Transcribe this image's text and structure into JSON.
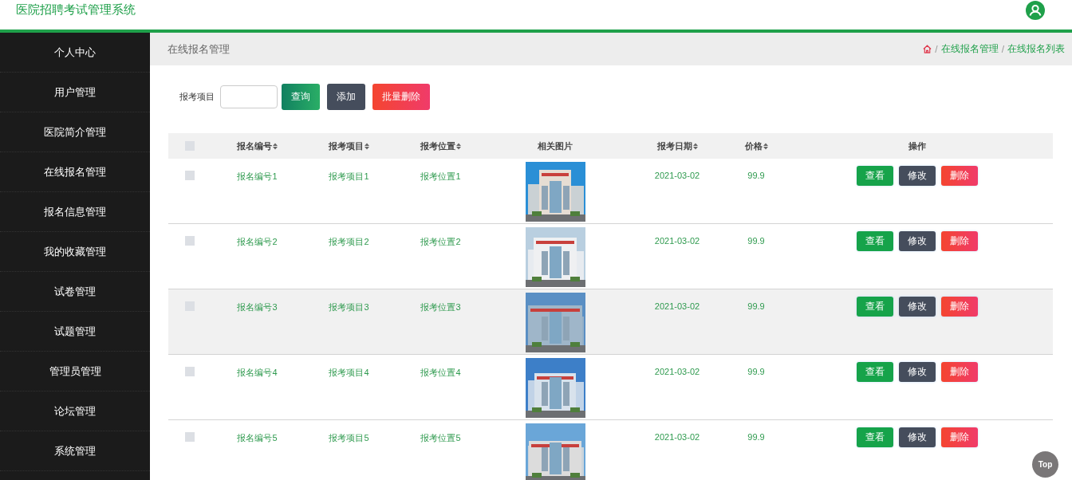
{
  "header": {
    "title": "医院招聘考试管理系统"
  },
  "sidebar": {
    "items": [
      {
        "label": "个人中心",
        "selected": false
      },
      {
        "label": "用户管理",
        "selected": false
      },
      {
        "label": "医院简介管理",
        "selected": false
      },
      {
        "label": "在线报名管理",
        "selected": false
      },
      {
        "label": "报名信息管理",
        "selected": false
      },
      {
        "label": "我的收藏管理",
        "selected": false
      },
      {
        "label": "试卷管理",
        "selected": false
      },
      {
        "label": "试题管理",
        "selected": false
      },
      {
        "label": "管理员管理",
        "selected": false
      },
      {
        "label": "论坛管理",
        "selected": false
      },
      {
        "label": "系统管理",
        "selected": false
      }
    ]
  },
  "page_title": "在线报名管理",
  "breadcrumb": [
    {
      "separator": "/",
      "label": "在线报名管理"
    },
    {
      "separator": "/",
      "label": "在线报名列表"
    }
  ],
  "search": {
    "label": "报考项目",
    "buttons": [
      {
        "label": "查询",
        "kind": "search"
      },
      {
        "label": "添加",
        "kind": "add"
      },
      {
        "label": "批量删除",
        "kind": "delete"
      }
    ]
  },
  "table": {
    "columns": [
      {
        "label": "报名编号",
        "sortable": true
      },
      {
        "label": "报考项目",
        "sortable": true
      },
      {
        "label": "报考位置",
        "sortable": true
      },
      {
        "label": "相关图片",
        "sortable": false
      },
      {
        "label": "报考日期",
        "sortable": true
      },
      {
        "label": "价格",
        "sortable": true
      },
      {
        "label": "操作",
        "sortable": false
      }
    ],
    "header_checked": false,
    "rows": [
      {
        "checked": false,
        "highlighted": false,
        "cells": [
          "报名编号1",
          "报考项目1",
          "报考位置1",
          {
            "kind": "picture"
          },
          "2021-03-02",
          "99.9",
          {
            "kind": "actions",
            "buttons": [
              {
                "label": "查看",
                "kind": "view"
              },
              {
                "label": "修改",
                "kind": "edit"
              },
              {
                "label": "删除",
                "kind": "delete"
              }
            ]
          }
        ]
      },
      {
        "checked": false,
        "highlighted": false,
        "cells": [
          "报名编号2",
          "报考项目2",
          "报考位置2",
          {
            "kind": "picture"
          },
          "2021-03-02",
          "99.9",
          {
            "kind": "actions",
            "buttons": [
              {
                "label": "查看",
                "kind": "view"
              },
              {
                "label": "修改",
                "kind": "edit"
              },
              {
                "label": "删除",
                "kind": "delete"
              }
            ]
          }
        ]
      },
      {
        "checked": false,
        "highlighted": true,
        "cells": [
          "报名编号3",
          "报考项目3",
          "报考位置3",
          {
            "kind": "picture"
          },
          "2021-03-02",
          "99.9",
          {
            "kind": "actions",
            "buttons": [
              {
                "label": "查看",
                "kind": "view"
              },
              {
                "label": "修改",
                "kind": "edit"
              },
              {
                "label": "删除",
                "kind": "delete"
              }
            ]
          }
        ]
      },
      {
        "checked": false,
        "highlighted": false,
        "cells": [
          "报名编号4",
          "报考项目4",
          "报考位置4",
          {
            "kind": "picture"
          },
          "2021-03-02",
          "99.9",
          {
            "kind": "actions",
            "buttons": [
              {
                "label": "查看",
                "kind": "view"
              },
              {
                "label": "修改",
                "kind": "edit"
              },
              {
                "label": "删除",
                "kind": "delete"
              }
            ]
          }
        ]
      },
      {
        "checked": false,
        "highlighted": false,
        "cells": [
          "报名编号5",
          "报考项目5",
          "报考位置5",
          {
            "kind": "picture"
          },
          "2021-03-02",
          "99.9",
          {
            "kind": "actions",
            "buttons": [
              {
                "label": "查看",
                "kind": "view"
              },
              {
                "label": "修改",
                "kind": "edit"
              },
              {
                "label": "删除",
                "kind": "delete"
              }
            ]
          }
        ]
      }
    ]
  },
  "back_to_top": "Top"
}
